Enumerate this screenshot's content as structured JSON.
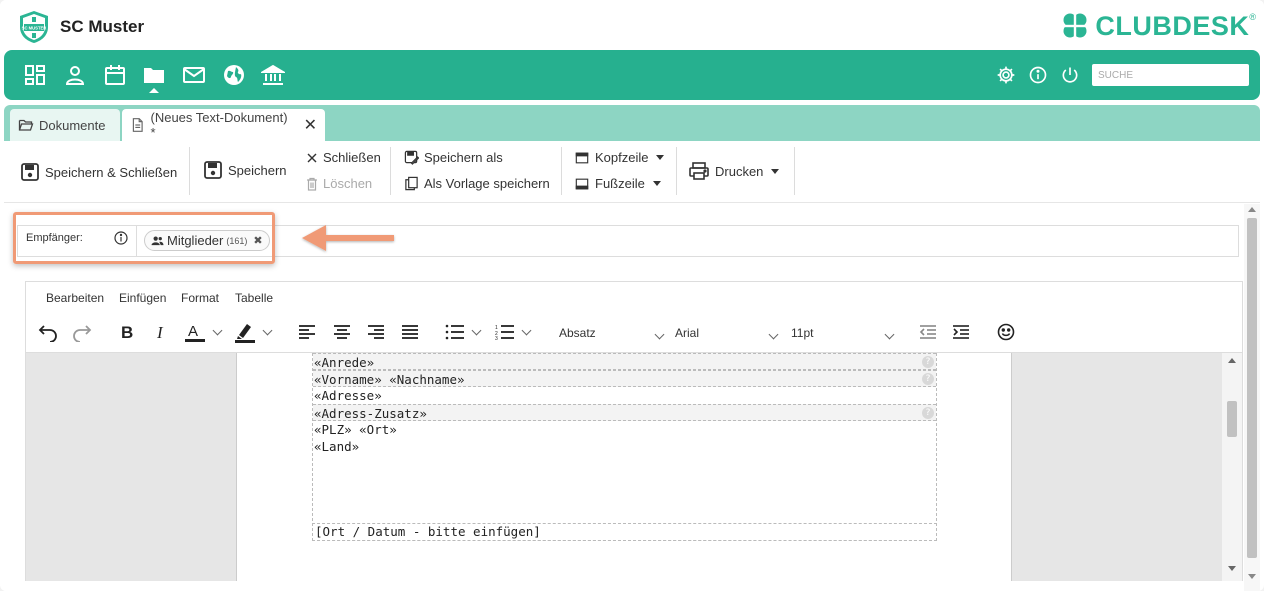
{
  "header": {
    "club_name": "SC Muster",
    "club_logo_text": "SC MUSTER",
    "brand_name": "CLUBDESK",
    "brand_reg": "®",
    "brand_color": "#2bb594"
  },
  "nav": {
    "accent": "#26b08f",
    "icons": [
      "dashboard-icon",
      "person-icon",
      "calendar-icon",
      "folder-icon",
      "mail-icon",
      "globe-icon",
      "bank-icon"
    ],
    "active": "folder-icon",
    "right_icons": [
      "gear-icon",
      "info-icon",
      "power-icon"
    ],
    "search_placeholder": "SUCHE"
  },
  "tabs": [
    {
      "label": "Dokumente",
      "icon": "folder-open-icon"
    },
    {
      "label": "(Neues Text-Dokument) *",
      "icon": "document-icon",
      "closable": true,
      "close": "✕"
    }
  ],
  "toolbar": {
    "save_close": "Speichern & Schließen",
    "save": "Speichern",
    "close": "Schließen",
    "delete": "Löschen",
    "save_as": "Speichern als",
    "save_template": "Als Vorlage speichern",
    "header": "Kopfzeile",
    "footer": "Fußzeile",
    "print": "Drucken"
  },
  "recipient": {
    "label": "Empfänger:",
    "chip_label": "Mitglieder",
    "chip_count": "(161)",
    "chip_remove": "✖"
  },
  "editor": {
    "menus": [
      "Bearbeiten",
      "Einfügen",
      "Format",
      "Tabelle"
    ],
    "block_format": "Absatz",
    "font_family": "Arial",
    "font_size": "11pt",
    "lines": [
      {
        "text": "«Anrede»",
        "shaded": true
      },
      {
        "text": "«Vorname» «Nachname»",
        "shaded": true
      },
      {
        "text": "«Adresse»",
        "shaded": false
      },
      {
        "text": "«Adress-Zusatz»",
        "shaded": true
      },
      {
        "text": "«PLZ» «Ort»",
        "shaded": false
      },
      {
        "text": "«Land»",
        "shaded": false
      }
    ],
    "field_help": "?",
    "date_placeholder": "[Ort / Datum - bitte einfügen]"
  },
  "annotation": {
    "highlight_color": "#f09a76"
  }
}
